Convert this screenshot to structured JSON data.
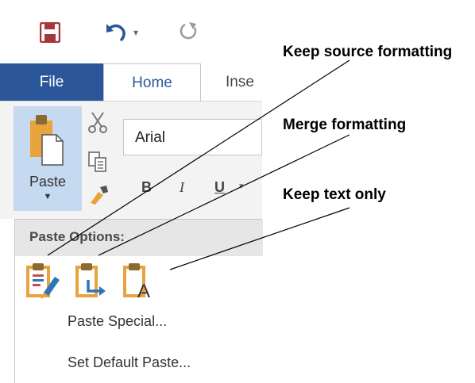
{
  "ribbon": {
    "tabs": [
      "File",
      "Home",
      "Inse"
    ],
    "paste_label": "Paste",
    "font_name": "Arial",
    "bold_label": "B",
    "italic_label": "I",
    "underline_label": "U"
  },
  "dropdown": {
    "header": "Paste Options:",
    "paste_special": "Paste Special...",
    "set_default_paste": "Set Default Paste..."
  },
  "callouts": {
    "keep_source": "Keep source formatting",
    "merge": "Merge formatting",
    "keep_text": "Keep text only"
  },
  "colors": {
    "file_tab": "#2b579a",
    "save_icon": "#a4373a",
    "accent_orange": "#e8a33d",
    "accent_blue": "#2e75b6"
  },
  "icons": {
    "save": "save-icon",
    "undo": "undo-icon",
    "redo": "redo-icon",
    "cut": "cut-icon",
    "copy": "copy-icon",
    "format_painter": "format-painter-icon"
  }
}
